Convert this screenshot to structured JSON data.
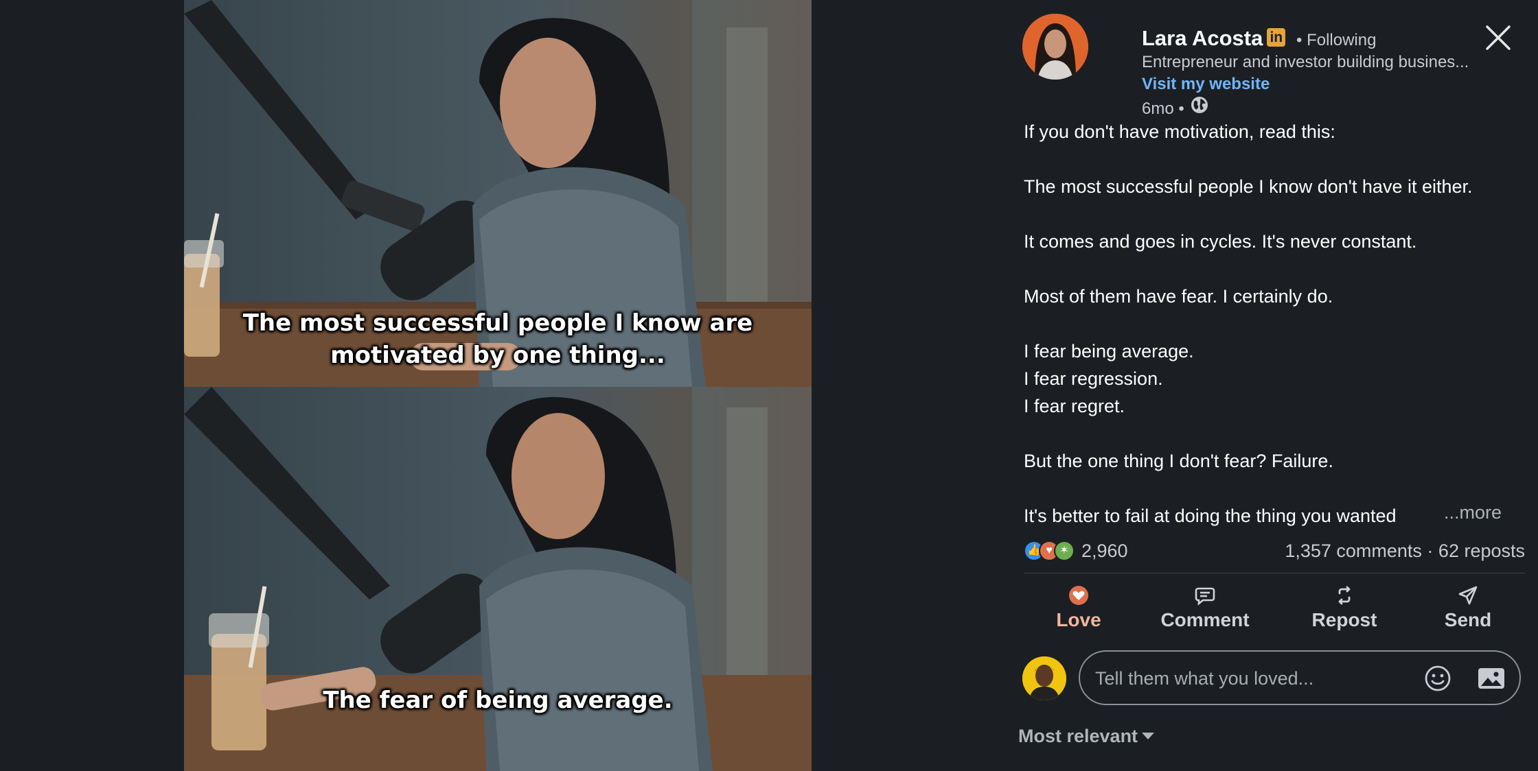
{
  "media": {
    "caption_top": "The most successful people I know are motivated by one thing...",
    "caption_bottom": "The fear of being average."
  },
  "author": {
    "name": "Lara Acosta",
    "badge": "in",
    "following": "• Following",
    "headline": "Entrepreneur and investor building busines...",
    "website_label": "Visit my website",
    "time": "6mo •"
  },
  "post": {
    "lines": [
      "If you don't have motivation, read this:",
      "",
      "The most successful people I know don't have it either.",
      "",
      "It comes and goes in cycles. It's never constant.",
      "",
      "Most of them have fear. I certainly do.",
      "",
      "I fear being average.",
      "I fear regression.",
      "I fear regret.",
      "",
      "But the one thing I don't fear? Failure.",
      "",
      "It's better to fail at doing the thing you wanted"
    ],
    "more_label": "...more"
  },
  "stats": {
    "reaction_count": "2,960",
    "comments_reposts": "1,357 comments · 62 reposts",
    "reaction_icons": [
      "like-icon",
      "love-icon",
      "celebrate-icon"
    ]
  },
  "actions": {
    "love": "Love",
    "comment": "Comment",
    "repost": "Repost",
    "send": "Send"
  },
  "comment": {
    "placeholder": "Tell them what you loved..."
  },
  "sort": {
    "label": "Most relevant"
  },
  "colors": {
    "background": "#1b1f23",
    "link": "#70b5f9",
    "love_label": "#f3b59e",
    "badge": "#e6a23c"
  }
}
